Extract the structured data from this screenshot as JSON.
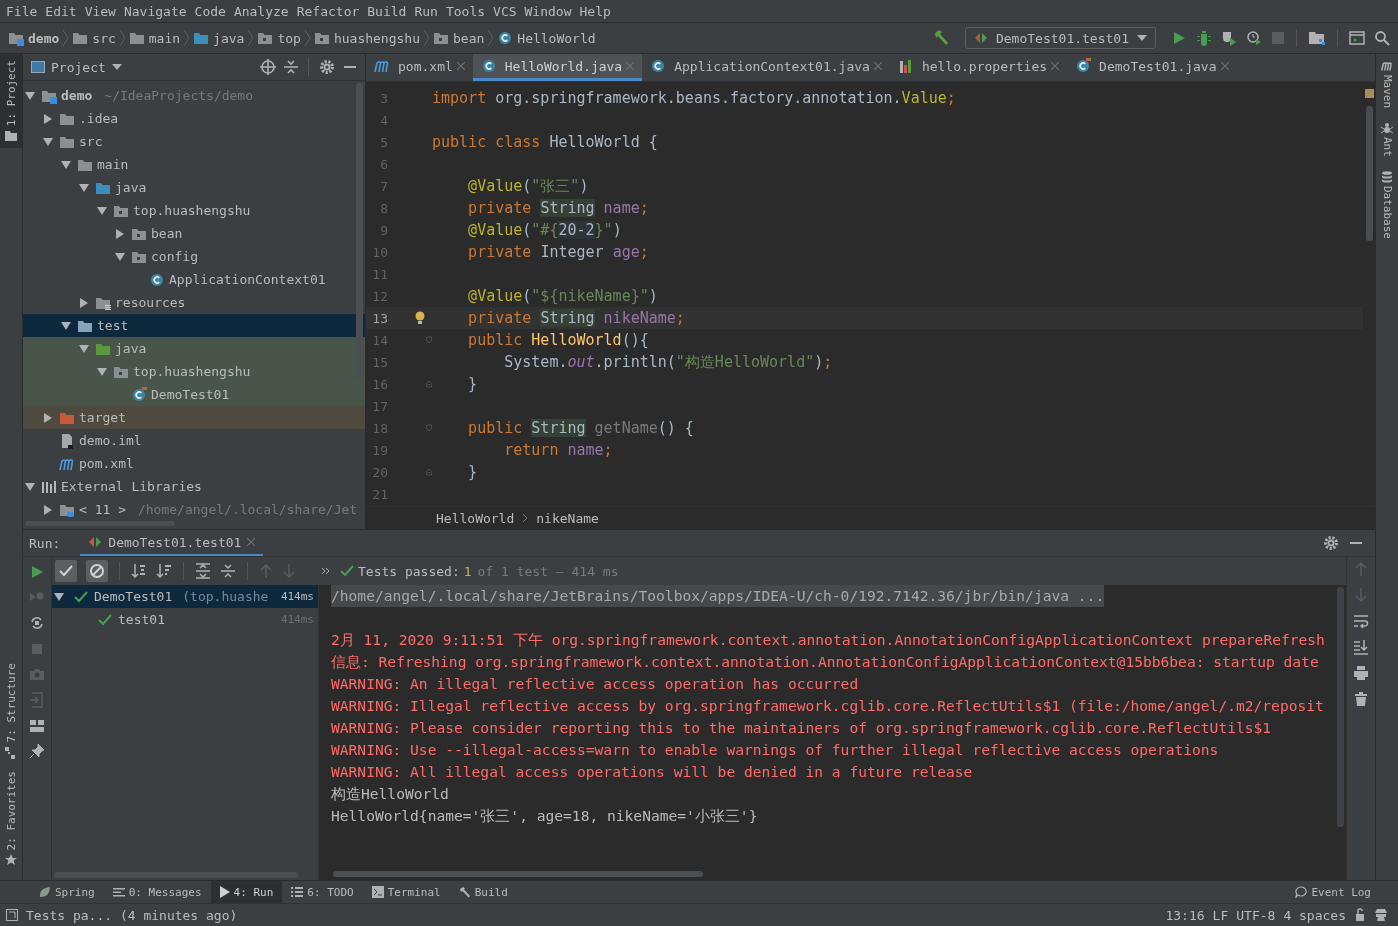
{
  "menu": [
    "File",
    "Edit",
    "View",
    "Navigate",
    "Code",
    "Analyze",
    "Refactor",
    "Build",
    "Run",
    "Tools",
    "VCS",
    "Window",
    "Help"
  ],
  "breadcrumbs": [
    {
      "label": "demo",
      "kind": "module"
    },
    {
      "label": "src",
      "kind": "folder"
    },
    {
      "label": "main",
      "kind": "folder"
    },
    {
      "label": "java",
      "kind": "source"
    },
    {
      "label": "top",
      "kind": "package"
    },
    {
      "label": "huashengshu",
      "kind": "package"
    },
    {
      "label": "bean",
      "kind": "package"
    },
    {
      "label": "HelloWorld",
      "kind": "class"
    }
  ],
  "run_config": "DemoTest01.test01",
  "left_stripe": {
    "top": [
      {
        "label": "1: Project",
        "kind": "project",
        "selected": true
      }
    ],
    "bottom": [
      {
        "label": "7: Structure",
        "kind": "structure",
        "selected": false
      },
      {
        "label": "2: Favorites",
        "kind": "favorites",
        "selected": false
      }
    ]
  },
  "right_stripe": [
    {
      "label": "Maven",
      "kind": "maven"
    },
    {
      "label": "Ant",
      "kind": "ant"
    },
    {
      "label": "Database",
      "kind": "database"
    }
  ],
  "project": {
    "title": "Project",
    "tree": [
      {
        "label": "demo",
        "note": "~/IdeaProjects/demo",
        "kind": "module",
        "expanded": true,
        "selected": false,
        "children": [
          {
            "label": ".idea",
            "kind": "folder",
            "expanded": false,
            "selected": false
          },
          {
            "label": "src",
            "kind": "folder",
            "expanded": true,
            "selected": false,
            "children": [
              {
                "label": "main",
                "kind": "folder",
                "expanded": true,
                "selected": false,
                "children": [
                  {
                    "label": "java",
                    "kind": "source",
                    "expanded": true,
                    "selected": false,
                    "children": [
                      {
                        "label": "top.huashengshu",
                        "kind": "package",
                        "expanded": true,
                        "selected": false,
                        "children": [
                          {
                            "label": "bean",
                            "kind": "package",
                            "expanded": false,
                            "selected": false
                          },
                          {
                            "label": "config",
                            "kind": "package",
                            "expanded": true,
                            "selected": false,
                            "children": [
                              {
                                "label": "ApplicationContext01",
                                "kind": "class",
                                "selected": false
                              }
                            ]
                          }
                        ]
                      }
                    ]
                  },
                  {
                    "label": "resources",
                    "kind": "resources",
                    "expanded": false,
                    "selected": false
                  }
                ]
              },
              {
                "label": "test",
                "kind": "test-root",
                "expanded": true,
                "selected": true,
                "children": [
                  {
                    "label": "java",
                    "kind": "test-source",
                    "test_scope": true,
                    "expanded": true,
                    "selected": false,
                    "children": [
                      {
                        "label": "top.huashengshu",
                        "kind": "package",
                        "test_scope": true,
                        "expanded": true,
                        "selected": false,
                        "children": [
                          {
                            "label": "DemoTest01",
                            "kind": "test-class",
                            "test_scope": true,
                            "selected": false
                          }
                        ]
                      }
                    ]
                  }
                ]
              }
            ]
          },
          {
            "label": "target",
            "kind": "excluded",
            "excluded": true,
            "expanded": false,
            "selected": false
          },
          {
            "label": "demo.iml",
            "kind": "file",
            "selected": false
          },
          {
            "label": "pom.xml",
            "kind": "maven",
            "selected": false
          }
        ]
      },
      {
        "label": "External Libraries",
        "kind": "libraries",
        "expanded": true,
        "selected": false,
        "children": [
          {
            "label": "< 11 >",
            "note": "/home/angel/.local/share/Jet",
            "kind": "sdk",
            "expanded": false,
            "selected": false
          }
        ]
      }
    ]
  },
  "tabs": [
    {
      "label": "pom.xml",
      "kind": "maven",
      "selected": false
    },
    {
      "label": "HelloWorld.java",
      "kind": "class",
      "selected": true
    },
    {
      "label": "ApplicationContext01.java",
      "kind": "class",
      "selected": false
    },
    {
      "label": "hello.properties",
      "kind": "properties",
      "selected": false
    },
    {
      "label": "DemoTest01.java",
      "kind": "test-class",
      "selected": false
    }
  ],
  "code": [
    {
      "num": "3",
      "current": false,
      "tokens": [
        {
          "kind": "kw",
          "text": "import"
        },
        {
          "kind": "plain",
          "text": " org.springframework.beans.factory.annotation."
        },
        {
          "kind": "ann",
          "text": "Value"
        },
        {
          "kind": "kw",
          "text": ";"
        }
      ]
    },
    {
      "num": "4",
      "current": false
    },
    {
      "num": "5",
      "current": false,
      "tokens": [
        {
          "kind": "kw",
          "text": "public class "
        },
        {
          "kind": "plain",
          "text": "HelloWorld {"
        }
      ]
    },
    {
      "num": "6",
      "current": false
    },
    {
      "num": "7",
      "current": false,
      "tokens": [
        {
          "kind": "ann",
          "text": "    @Value"
        },
        {
          "kind": "plain",
          "text": "("
        },
        {
          "kind": "str",
          "text": "\"张三\""
        },
        {
          "kind": "plain",
          "text": ")"
        }
      ]
    },
    {
      "num": "8",
      "current": false,
      "tokens": [
        {
          "kind": "kw",
          "text": "    private "
        },
        {
          "kind": "hl",
          "text": "String"
        },
        {
          "kind": "field",
          "text": " name"
        },
        {
          "kind": "kw",
          "text": ";"
        }
      ]
    },
    {
      "num": "9",
      "current": false,
      "tokens": [
        {
          "kind": "ann",
          "text": "    @Value"
        },
        {
          "kind": "plain",
          "text": "("
        },
        {
          "kind": "str",
          "text": "\"#{"
        },
        {
          "kind": "expr",
          "text": "20-2"
        },
        {
          "kind": "str",
          "text": "}\""
        },
        {
          "kind": "plain",
          "text": ")"
        }
      ]
    },
    {
      "num": "10",
      "current": false,
      "tokens": [
        {
          "kind": "kw",
          "text": "    private "
        },
        {
          "kind": "plain",
          "text": "Integer "
        },
        {
          "kind": "field",
          "text": "age"
        },
        {
          "kind": "kw",
          "text": ";"
        }
      ]
    },
    {
      "num": "11",
      "current": false
    },
    {
      "num": "12",
      "current": false,
      "tokens": [
        {
          "kind": "ann",
          "text": "    @Value"
        },
        {
          "kind": "plain",
          "text": "("
        },
        {
          "kind": "str",
          "text": "\"${nikeName}\""
        },
        {
          "kind": "plain",
          "text": ")"
        }
      ]
    },
    {
      "num": "13",
      "current": true,
      "bulb": true,
      "tokens": [
        {
          "kind": "kw",
          "text": "    private "
        },
        {
          "kind": "hl",
          "text": "String"
        },
        {
          "kind": "field",
          "text": " nikeName"
        },
        {
          "kind": "kw",
          "text": ";"
        }
      ]
    },
    {
      "num": "14",
      "current": false,
      "fold_start": true,
      "tokens": [
        {
          "kind": "kw",
          "text": "    public "
        },
        {
          "kind": "method",
          "text": "HelloWorld"
        },
        {
          "kind": "plain",
          "text": "(){"
        }
      ]
    },
    {
      "num": "15",
      "current": false,
      "tokens": [
        {
          "kind": "plain",
          "text": "        System."
        },
        {
          "kind": "static",
          "text": "out"
        },
        {
          "kind": "plain",
          "text": ".println("
        },
        {
          "kind": "str",
          "text": "\"构造HelloWorld\""
        },
        {
          "kind": "plain",
          "text": ")"
        },
        {
          "kind": "kw",
          "text": ";"
        }
      ]
    },
    {
      "num": "16",
      "current": false,
      "fold_end": true,
      "tokens": [
        {
          "kind": "plain",
          "text": "    }"
        }
      ]
    },
    {
      "num": "17",
      "current": false
    },
    {
      "num": "18",
      "current": false,
      "fold_start": true,
      "tokens": [
        {
          "kind": "kw",
          "text": "    public "
        },
        {
          "kind": "hl",
          "text": "String"
        },
        {
          "kind": "unused",
          "text": " getName"
        },
        {
          "kind": "plain",
          "text": "() {"
        }
      ]
    },
    {
      "num": "19",
      "current": false,
      "tokens": [
        {
          "kind": "kw",
          "text": "        return "
        },
        {
          "kind": "field",
          "text": "name"
        },
        {
          "kind": "kw",
          "text": ";"
        }
      ]
    },
    {
      "num": "20",
      "current": false,
      "fold_end": true,
      "tokens": [
        {
          "kind": "plain",
          "text": "    }"
        }
      ]
    },
    {
      "num": "21",
      "current": false
    }
  ],
  "editor_breadcrumbs": [
    "HelloWorld",
    "nikeName"
  ],
  "run": {
    "label": "Run:",
    "tab": "DemoTest01.test01",
    "toggles": [
      {
        "kind": "passed",
        "on": true
      },
      {
        "kind": "ignored",
        "on": true
      }
    ],
    "summary": {
      "label": "Tests passed:",
      "count": "1",
      "detail": "of 1 test – 414 ms"
    },
    "tests": [
      {
        "label": "DemoTest01",
        "note": "(top.huashe",
        "time": "414ms",
        "passed": true,
        "selected": true,
        "expanded": true,
        "children": [
          {
            "label": "test01",
            "time": "414ms",
            "passed": true,
            "selected": false
          }
        ]
      }
    ],
    "console": [
      {
        "kind": "cmd",
        "text": "/home/angel/.local/share/JetBrains/Toolbox/apps/IDEA-U/ch-0/192.7142.36/jbr/bin/java ..."
      },
      {
        "kind": "err",
        "gap": true,
        "text": "2月 11, 2020 9:11:51 下午 org.springframework.context.annotation.AnnotationConfigApplicationContext prepareRefresh"
      },
      {
        "kind": "err",
        "text": "信息: Refreshing org.springframework.context.annotation.AnnotationConfigApplicationContext@15bb6bea: startup date"
      },
      {
        "kind": "err",
        "text": "WARNING: An illegal reflective access operation has occurred"
      },
      {
        "kind": "err",
        "text": "WARNING: Illegal reflective access by org.springframework.cglib.core.ReflectUtils$1 (file:/home/angel/.m2/reposit"
      },
      {
        "kind": "err",
        "text": "WARNING: Please consider reporting this to the maintainers of org.springframework.cglib.core.ReflectUtils$1"
      },
      {
        "kind": "err",
        "text": "WARNING: Use --illegal-access=warn to enable warnings of further illegal reflective access operations"
      },
      {
        "kind": "err",
        "text": "WARNING: All illegal access operations will be denied in a future release"
      },
      {
        "kind": "out",
        "text": "构造HelloWorld"
      },
      {
        "kind": "out",
        "text": "HelloWorld{name='张三', age=18, nikeName='小张三'}"
      }
    ]
  },
  "tool_buttons": [
    {
      "label": "Spring",
      "kind": "spring",
      "selected": false
    },
    {
      "label": "0: Messages",
      "kind": "messages",
      "selected": false
    },
    {
      "label": "4: Run",
      "kind": "run",
      "selected": true
    },
    {
      "label": "6: TODO",
      "kind": "todo",
      "selected": false
    },
    {
      "label": "Terminal",
      "kind": "terminal",
      "selected": false
    },
    {
      "label": "Build",
      "kind": "build",
      "selected": false
    }
  ],
  "event_log": "Event Log",
  "status": {
    "message": "Tests pa... (4 minutes ago)",
    "fields": [
      "13:16",
      "LF",
      "UTF-8",
      "4 spaces"
    ]
  }
}
